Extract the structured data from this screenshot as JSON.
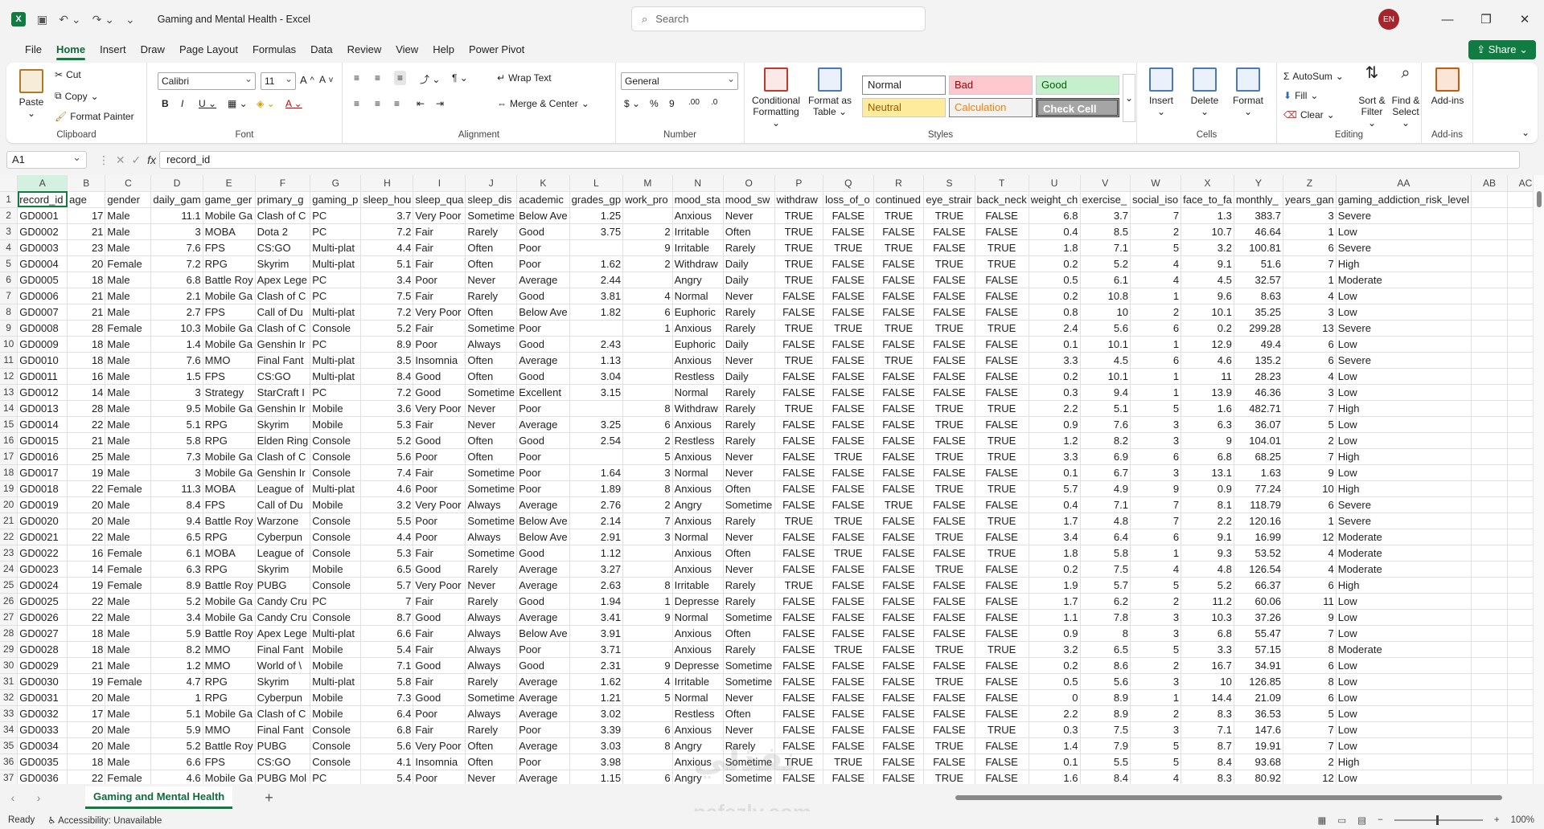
{
  "app": {
    "title": "Gaming and Mental Health",
    "app_name": "Excel",
    "title_separator": " - ",
    "search_placeholder": "Search",
    "user_initials": "EN"
  },
  "menu": [
    "File",
    "Home",
    "Insert",
    "Draw",
    "Page Layout",
    "Formulas",
    "Data",
    "Review",
    "View",
    "Help",
    "Power Pivot"
  ],
  "share_label": "Share",
  "ribbon": {
    "clipboard": {
      "paste": "Paste",
      "cut": "Cut",
      "copy": "Copy",
      "format_painter": "Format Painter",
      "label": "Clipboard"
    },
    "font": {
      "name": "Calibri",
      "size": "11",
      "label": "Font"
    },
    "alignment": {
      "wrap_text": "Wrap Text",
      "merge_center": "Merge & Center",
      "label": "Alignment"
    },
    "number": {
      "format": "General",
      "label": "Number"
    },
    "styles": {
      "conditional": "Conditional Formatting",
      "format_table": "Format as Table",
      "normal": "Normal",
      "bad": "Bad",
      "good": "Good",
      "neutral": "Neutral",
      "calculation": "Calculation",
      "check_cell": "Check Cell",
      "label": "Styles"
    },
    "cells": {
      "insert": "Insert",
      "delete": "Delete",
      "format": "Format",
      "label": "Cells"
    },
    "editing": {
      "autosum": "AutoSum",
      "fill": "Fill",
      "clear": "Clear",
      "sort_filter": "Sort & Filter",
      "find_select": "Find & Select",
      "label": "Editing"
    },
    "addins": {
      "addins": "Add-ins",
      "label": "Add-ins"
    }
  },
  "formula_bar": {
    "name_box": "A1",
    "formula": "record_id"
  },
  "columns": [
    "A",
    "B",
    "C",
    "D",
    "E",
    "F",
    "G",
    "H",
    "I",
    "J",
    "K",
    "L",
    "M",
    "N",
    "O",
    "P",
    "Q",
    "R",
    "S",
    "T",
    "U",
    "V",
    "W",
    "X",
    "Y",
    "Z",
    "AA",
    "AB",
    "AC"
  ],
  "headers": [
    "record_id",
    "age",
    "gender",
    "daily_gam",
    "game_ger",
    "primary_g",
    "gaming_p",
    "sleep_hou",
    "sleep_qua",
    "sleep_dis",
    "academic",
    "grades_gp",
    "work_pro",
    "mood_sta",
    "mood_sw",
    "withdraw",
    "loss_of_o",
    "continued",
    "eye_strair",
    "back_neck",
    "weight_ch",
    "exercise_",
    "social_iso",
    "face_to_fa",
    "monthly_",
    "years_gan",
    "gaming_addiction_risk_level"
  ],
  "rows": [
    [
      "GD0001",
      "17",
      "Male",
      "11.1",
      "Mobile Ga",
      "Clash of C",
      "PC",
      "3.7",
      "Very Poor",
      "Sometime",
      "Below Ave",
      "1.25",
      "",
      "Anxious",
      "Never",
      "TRUE",
      "FALSE",
      "TRUE",
      "TRUE",
      "FALSE",
      "6.8",
      "3.7",
      "7",
      "1.3",
      "383.7",
      "3",
      "Severe"
    ],
    [
      "GD0002",
      "21",
      "Male",
      "3",
      "MOBA",
      "Dota 2",
      "PC",
      "7.2",
      "Fair",
      "Rarely",
      "Good",
      "3.75",
      "2",
      "Irritable",
      "Often",
      "TRUE",
      "FALSE",
      "FALSE",
      "FALSE",
      "FALSE",
      "0.4",
      "8.5",
      "2",
      "10.7",
      "46.64",
      "1",
      "Low"
    ],
    [
      "GD0003",
      "23",
      "Male",
      "7.6",
      "FPS",
      "CS:GO",
      "Multi-plat",
      "4.4",
      "Fair",
      "Often",
      "Poor",
      "",
      "9",
      "Irritable",
      "Rarely",
      "TRUE",
      "TRUE",
      "TRUE",
      "FALSE",
      "TRUE",
      "1.8",
      "7.1",
      "5",
      "3.2",
      "100.81",
      "6",
      "Severe"
    ],
    [
      "GD0004",
      "20",
      "Female",
      "7.2",
      "RPG",
      "Skyrim",
      "Multi-plat",
      "5.1",
      "Fair",
      "Often",
      "Poor",
      "1.62",
      "2",
      "Withdraw",
      "Daily",
      "TRUE",
      "FALSE",
      "FALSE",
      "TRUE",
      "TRUE",
      "0.2",
      "5.2",
      "4",
      "9.1",
      "51.6",
      "7",
      "High"
    ],
    [
      "GD0005",
      "18",
      "Male",
      "6.8",
      "Battle Roy",
      "Apex Lege",
      "PC",
      "3.4",
      "Poor",
      "Never",
      "Average",
      "2.44",
      "",
      "Angry",
      "Daily",
      "TRUE",
      "FALSE",
      "FALSE",
      "FALSE",
      "FALSE",
      "0.5",
      "6.1",
      "4",
      "4.5",
      "32.57",
      "1",
      "Moderate"
    ],
    [
      "GD0006",
      "21",
      "Male",
      "2.1",
      "Mobile Ga",
      "Clash of C",
      "PC",
      "7.5",
      "Fair",
      "Rarely",
      "Good",
      "3.81",
      "4",
      "Normal",
      "Never",
      "FALSE",
      "FALSE",
      "FALSE",
      "FALSE",
      "FALSE",
      "0.2",
      "10.8",
      "1",
      "9.6",
      "8.63",
      "4",
      "Low"
    ],
    [
      "GD0007",
      "21",
      "Male",
      "2.7",
      "FPS",
      "Call of Du",
      "Multi-plat",
      "7.2",
      "Very Poor",
      "Often",
      "Below Ave",
      "1.82",
      "6",
      "Euphoric",
      "Rarely",
      "FALSE",
      "FALSE",
      "FALSE",
      "FALSE",
      "FALSE",
      "0.8",
      "10",
      "2",
      "10.1",
      "35.25",
      "3",
      "Low"
    ],
    [
      "GD0008",
      "28",
      "Female",
      "10.3",
      "Mobile Ga",
      "Clash of C",
      "Console",
      "5.2",
      "Fair",
      "Sometime",
      "Poor",
      "",
      "1",
      "Anxious",
      "Rarely",
      "TRUE",
      "TRUE",
      "TRUE",
      "TRUE",
      "TRUE",
      "2.4",
      "5.6",
      "6",
      "0.2",
      "299.28",
      "13",
      "Severe"
    ],
    [
      "GD0009",
      "18",
      "Male",
      "1.4",
      "Mobile Ga",
      "Genshin Ir",
      "PC",
      "8.9",
      "Poor",
      "Always",
      "Good",
      "2.43",
      "",
      "Euphoric",
      "Daily",
      "FALSE",
      "FALSE",
      "FALSE",
      "FALSE",
      "FALSE",
      "0.1",
      "10.1",
      "1",
      "12.9",
      "49.4",
      "6",
      "Low"
    ],
    [
      "GD0010",
      "18",
      "Male",
      "7.6",
      "MMO",
      "Final Fant",
      "Multi-plat",
      "3.5",
      "Insomnia",
      "Often",
      "Average",
      "1.13",
      "",
      "Anxious",
      "Never",
      "TRUE",
      "FALSE",
      "TRUE",
      "FALSE",
      "FALSE",
      "3.3",
      "4.5",
      "6",
      "4.6",
      "135.2",
      "6",
      "Severe"
    ],
    [
      "GD0011",
      "16",
      "Male",
      "1.5",
      "FPS",
      "CS:GO",
      "Multi-plat",
      "8.4",
      "Good",
      "Often",
      "Good",
      "3.04",
      "",
      "Restless",
      "Daily",
      "FALSE",
      "FALSE",
      "FALSE",
      "FALSE",
      "FALSE",
      "0.2",
      "10.1",
      "1",
      "11",
      "28.23",
      "4",
      "Low"
    ],
    [
      "GD0012",
      "14",
      "Male",
      "3",
      "Strategy",
      "StarCraft I",
      "PC",
      "7.2",
      "Good",
      "Sometime",
      "Excellent",
      "3.15",
      "",
      "Normal",
      "Rarely",
      "FALSE",
      "FALSE",
      "FALSE",
      "FALSE",
      "FALSE",
      "0.3",
      "9.4",
      "1",
      "13.9",
      "46.36",
      "3",
      "Low"
    ],
    [
      "GD0013",
      "28",
      "Male",
      "9.5",
      "Mobile Ga",
      "Genshin Ir",
      "Mobile",
      "3.6",
      "Very Poor",
      "Never",
      "Poor",
      "",
      "8",
      "Withdraw",
      "Rarely",
      "TRUE",
      "FALSE",
      "FALSE",
      "TRUE",
      "TRUE",
      "2.2",
      "5.1",
      "5",
      "1.6",
      "482.71",
      "7",
      "High"
    ],
    [
      "GD0014",
      "22",
      "Male",
      "5.1",
      "RPG",
      "Skyrim",
      "Mobile",
      "5.3",
      "Fair",
      "Never",
      "Average",
      "3.25",
      "6",
      "Anxious",
      "Rarely",
      "FALSE",
      "FALSE",
      "FALSE",
      "TRUE",
      "FALSE",
      "0.9",
      "7.6",
      "3",
      "6.3",
      "36.07",
      "5",
      "Low"
    ],
    [
      "GD0015",
      "21",
      "Male",
      "5.8",
      "RPG",
      "Elden Ring",
      "Console",
      "5.2",
      "Good",
      "Often",
      "Good",
      "2.54",
      "2",
      "Restless",
      "Rarely",
      "FALSE",
      "FALSE",
      "FALSE",
      "FALSE",
      "TRUE",
      "1.2",
      "8.2",
      "3",
      "9",
      "104.01",
      "2",
      "Low"
    ],
    [
      "GD0016",
      "25",
      "Male",
      "7.3",
      "Mobile Ga",
      "Clash of C",
      "Console",
      "5.6",
      "Poor",
      "Often",
      "Poor",
      "",
      "5",
      "Anxious",
      "Never",
      "FALSE",
      "TRUE",
      "FALSE",
      "TRUE",
      "TRUE",
      "3.3",
      "6.9",
      "6",
      "6.8",
      "68.25",
      "7",
      "High"
    ],
    [
      "GD0017",
      "19",
      "Male",
      "3",
      "Mobile Ga",
      "Genshin Ir",
      "Console",
      "7.4",
      "Fair",
      "Sometime",
      "Poor",
      "1.64",
      "3",
      "Normal",
      "Never",
      "FALSE",
      "FALSE",
      "FALSE",
      "FALSE",
      "FALSE",
      "0.1",
      "6.7",
      "3",
      "13.1",
      "1.63",
      "9",
      "Low"
    ],
    [
      "GD0018",
      "22",
      "Female",
      "11.3",
      "MOBA",
      "League of",
      "Multi-plat",
      "4.6",
      "Poor",
      "Sometime",
      "Poor",
      "1.89",
      "8",
      "Anxious",
      "Often",
      "FALSE",
      "FALSE",
      "FALSE",
      "TRUE",
      "TRUE",
      "5.7",
      "4.9",
      "9",
      "0.9",
      "77.24",
      "10",
      "High"
    ],
    [
      "GD0019",
      "20",
      "Male",
      "8.4",
      "FPS",
      "Call of Du",
      "Mobile",
      "3.2",
      "Very Poor",
      "Always",
      "Average",
      "2.76",
      "2",
      "Angry",
      "Sometime",
      "FALSE",
      "FALSE",
      "TRUE",
      "FALSE",
      "FALSE",
      "0.4",
      "7.1",
      "7",
      "8.1",
      "118.79",
      "6",
      "Severe"
    ],
    [
      "GD0020",
      "20",
      "Male",
      "9.4",
      "Battle Roy",
      "Warzone",
      "Console",
      "5.5",
      "Poor",
      "Sometime",
      "Below Ave",
      "2.14",
      "7",
      "Anxious",
      "Rarely",
      "TRUE",
      "TRUE",
      "FALSE",
      "FALSE",
      "TRUE",
      "1.7",
      "4.8",
      "7",
      "2.2",
      "120.16",
      "1",
      "Severe"
    ],
    [
      "GD0021",
      "22",
      "Male",
      "6.5",
      "RPG",
      "Cyberpun",
      "Console",
      "4.4",
      "Poor",
      "Always",
      "Below Ave",
      "2.91",
      "3",
      "Normal",
      "Never",
      "FALSE",
      "FALSE",
      "FALSE",
      "TRUE",
      "FALSE",
      "3.4",
      "6.4",
      "6",
      "9.1",
      "16.99",
      "12",
      "Moderate"
    ],
    [
      "GD0022",
      "16",
      "Female",
      "6.1",
      "MOBA",
      "League of",
      "Console",
      "5.3",
      "Fair",
      "Sometime",
      "Good",
      "1.12",
      "",
      "Anxious",
      "Often",
      "FALSE",
      "TRUE",
      "FALSE",
      "FALSE",
      "TRUE",
      "1.8",
      "5.8",
      "1",
      "9.3",
      "53.52",
      "4",
      "Moderate"
    ],
    [
      "GD0023",
      "14",
      "Female",
      "6.3",
      "RPG",
      "Skyrim",
      "Mobile",
      "6.5",
      "Good",
      "Rarely",
      "Average",
      "3.27",
      "",
      "Anxious",
      "Never",
      "FALSE",
      "FALSE",
      "FALSE",
      "TRUE",
      "FALSE",
      "0.2",
      "7.5",
      "4",
      "4.8",
      "126.54",
      "4",
      "Moderate"
    ],
    [
      "GD0024",
      "19",
      "Female",
      "8.9",
      "Battle Roy",
      "PUBG",
      "Console",
      "5.7",
      "Very Poor",
      "Never",
      "Average",
      "2.63",
      "8",
      "Irritable",
      "Rarely",
      "TRUE",
      "FALSE",
      "FALSE",
      "FALSE",
      "FALSE",
      "1.9",
      "5.7",
      "5",
      "5.2",
      "66.37",
      "6",
      "High"
    ],
    [
      "GD0025",
      "22",
      "Male",
      "5.2",
      "Mobile Ga",
      "Candy Cru",
      "PC",
      "7",
      "Fair",
      "Rarely",
      "Good",
      "1.94",
      "1",
      "Depresse",
      "Rarely",
      "FALSE",
      "FALSE",
      "FALSE",
      "FALSE",
      "FALSE",
      "1.7",
      "6.2",
      "2",
      "11.2",
      "60.06",
      "11",
      "Low"
    ],
    [
      "GD0026",
      "22",
      "Male",
      "3.4",
      "Mobile Ga",
      "Candy Cru",
      "Console",
      "8.7",
      "Good",
      "Always",
      "Average",
      "3.41",
      "9",
      "Normal",
      "Sometime",
      "FALSE",
      "FALSE",
      "FALSE",
      "FALSE",
      "FALSE",
      "1.1",
      "7.8",
      "3",
      "10.3",
      "37.26",
      "9",
      "Low"
    ],
    [
      "GD0027",
      "18",
      "Male",
      "5.9",
      "Battle Roy",
      "Apex Lege",
      "Multi-plat",
      "6.6",
      "Fair",
      "Always",
      "Below Ave",
      "3.91",
      "",
      "Anxious",
      "Often",
      "FALSE",
      "FALSE",
      "FALSE",
      "FALSE",
      "FALSE",
      "0.9",
      "8",
      "3",
      "6.8",
      "55.47",
      "7",
      "Low"
    ],
    [
      "GD0028",
      "18",
      "Male",
      "8.2",
      "MMO",
      "Final Fant",
      "Mobile",
      "5.4",
      "Fair",
      "Always",
      "Poor",
      "3.71",
      "",
      "Anxious",
      "Rarely",
      "FALSE",
      "TRUE",
      "FALSE",
      "TRUE",
      "TRUE",
      "3.2",
      "6.5",
      "5",
      "3.3",
      "57.15",
      "8",
      "Moderate"
    ],
    [
      "GD0029",
      "21",
      "Male",
      "1.2",
      "MMO",
      "World of \\",
      "Mobile",
      "7.1",
      "Good",
      "Always",
      "Good",
      "2.31",
      "9",
      "Depresse",
      "Sometime",
      "FALSE",
      "FALSE",
      "FALSE",
      "FALSE",
      "FALSE",
      "0.2",
      "8.6",
      "2",
      "16.7",
      "34.91",
      "6",
      "Low"
    ],
    [
      "GD0030",
      "19",
      "Female",
      "4.7",
      "RPG",
      "Skyrim",
      "Multi-plat",
      "5.8",
      "Fair",
      "Rarely",
      "Average",
      "1.62",
      "4",
      "Irritable",
      "Sometime",
      "FALSE",
      "FALSE",
      "FALSE",
      "TRUE",
      "FALSE",
      "0.5",
      "5.6",
      "3",
      "10",
      "126.85",
      "8",
      "Low"
    ],
    [
      "GD0031",
      "20",
      "Male",
      "1",
      "RPG",
      "Cyberpun",
      "Mobile",
      "7.3",
      "Good",
      "Sometime",
      "Average",
      "1.21",
      "5",
      "Normal",
      "Never",
      "FALSE",
      "FALSE",
      "FALSE",
      "FALSE",
      "FALSE",
      "0",
      "8.9",
      "1",
      "14.4",
      "21.09",
      "6",
      "Low"
    ],
    [
      "GD0032",
      "17",
      "Male",
      "5.1",
      "Mobile Ga",
      "Clash of C",
      "Mobile",
      "6.4",
      "Poor",
      "Always",
      "Average",
      "3.02",
      "",
      "Restless",
      "Often",
      "FALSE",
      "FALSE",
      "FALSE",
      "FALSE",
      "FALSE",
      "2.2",
      "8.9",
      "2",
      "8.3",
      "36.53",
      "5",
      "Low"
    ],
    [
      "GD0033",
      "20",
      "Male",
      "5.9",
      "MMO",
      "Final Fant",
      "Console",
      "6.8",
      "Fair",
      "Rarely",
      "Poor",
      "3.39",
      "6",
      "Anxious",
      "Never",
      "FALSE",
      "FALSE",
      "FALSE",
      "FALSE",
      "TRUE",
      "0.3",
      "7.5",
      "3",
      "7.1",
      "147.6",
      "7",
      "Low"
    ],
    [
      "GD0034",
      "20",
      "Male",
      "5.2",
      "Battle Roy",
      "PUBG",
      "Console",
      "5.6",
      "Very Poor",
      "Often",
      "Average",
      "3.03",
      "8",
      "Angry",
      "Rarely",
      "FALSE",
      "FALSE",
      "FALSE",
      "TRUE",
      "FALSE",
      "1.4",
      "7.9",
      "5",
      "8.7",
      "19.91",
      "7",
      "Low"
    ],
    [
      "GD0035",
      "18",
      "Male",
      "6.6",
      "FPS",
      "CS:GO",
      "Console",
      "4.1",
      "Insomnia",
      "Often",
      "Poor",
      "3.98",
      "",
      "Anxious",
      "Sometime",
      "TRUE",
      "TRUE",
      "FALSE",
      "FALSE",
      "FALSE",
      "0.1",
      "5.5",
      "5",
      "8.4",
      "93.68",
      "2",
      "High"
    ],
    [
      "GD0036",
      "22",
      "Female",
      "4.6",
      "Mobile Ga",
      "PUBG Mol",
      "PC",
      "5.4",
      "Poor",
      "Never",
      "Average",
      "1.15",
      "6",
      "Angry",
      "Sometime",
      "FALSE",
      "FALSE",
      "FALSE",
      "TRUE",
      "FALSE",
      "1.6",
      "8.4",
      "4",
      "8.3",
      "80.92",
      "12",
      "Low"
    ]
  ],
  "sheet_tab": "Gaming and Mental Health",
  "status": {
    "ready": "Ready",
    "accessibility": "Accessibility: Unavailable",
    "zoom": "100%"
  },
  "watermark": {
    "main": "نفذلي",
    "sub": "nafezly.com"
  }
}
